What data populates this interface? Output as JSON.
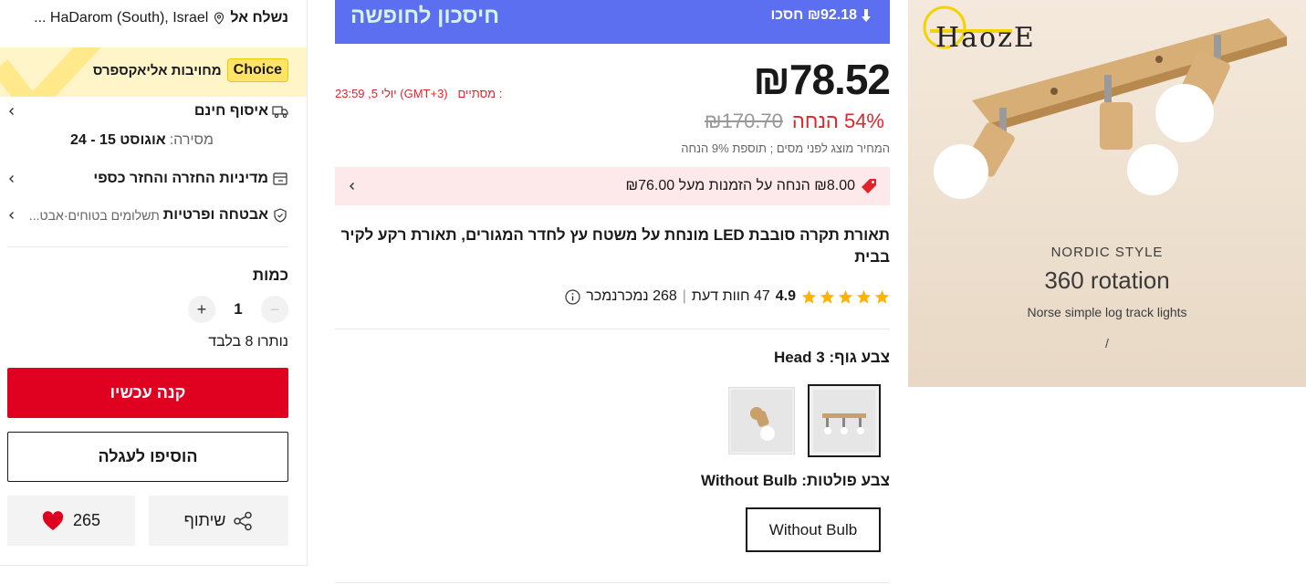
{
  "shipping": {
    "label": "נשלח אל",
    "location": "HaDarom (South), Israel ..."
  },
  "choice": {
    "badge": "Choice",
    "text": "מחויבות אליאקספרס"
  },
  "delivery": {
    "free_pickup": "איסוף חינם",
    "delivery_label": "מסירה:",
    "delivery_dates": "אוגוסט 15 - 24"
  },
  "returns": {
    "label": "מדיניות החזרה והחזר כספי"
  },
  "security": {
    "label": "אבטחה ופרטיות",
    "detail": "תשלומים בטוחים·אבט..."
  },
  "quantity": {
    "label": "כמות",
    "value": "1",
    "minus": "−",
    "plus": "+",
    "remaining": "נותרו 8 בלבד"
  },
  "actions": {
    "buy_now": "קנה עכשיו",
    "add_to_cart": "הוסיפו לעגלה",
    "share": "שיתוף",
    "wishlist_count": "265"
  },
  "banner": {
    "title": "חיסכון לחופשה",
    "save": "₪92.18 חסכו"
  },
  "pricing": {
    "price": "₪78.52",
    "ends_label": "מסתיים :",
    "ends_time": "יולי 5, 23:59 (GMT+3)",
    "old_price": "₪170.70",
    "discount": "54% הנחה",
    "tax_note": "המחיר מוצג לפני מסים ; תוספת 9% הנחה"
  },
  "coupon": {
    "text": "₪8.00 הנחה על הזמנות מעל ₪76.00"
  },
  "product": {
    "title": "תאורת תקרה סובבת LED מונחת על משטח עץ לחדר המגורים, תאורת רקע לקיר בבית",
    "rating": "4.9",
    "reviews": "47 חוות דעת",
    "sold": "268 נמכרנמכר"
  },
  "variants": {
    "color_label": "צבע גוף: 3 Head",
    "plug_label": "צבע פולטות: Without Bulb",
    "plug_option": "Without Bulb"
  },
  "image": {
    "brand": "HaozE",
    "style": "NORDIC STYLE",
    "rotation": "360 rotation",
    "subtitle": "Norse simple log track lights",
    "mark": "/"
  },
  "colors": {
    "red": "#e00020",
    "banner_blue": "#5b6ff0",
    "coupon_pink": "#fde8ea",
    "choice_yellow": "#fff5c8",
    "star": "#fdb400"
  }
}
